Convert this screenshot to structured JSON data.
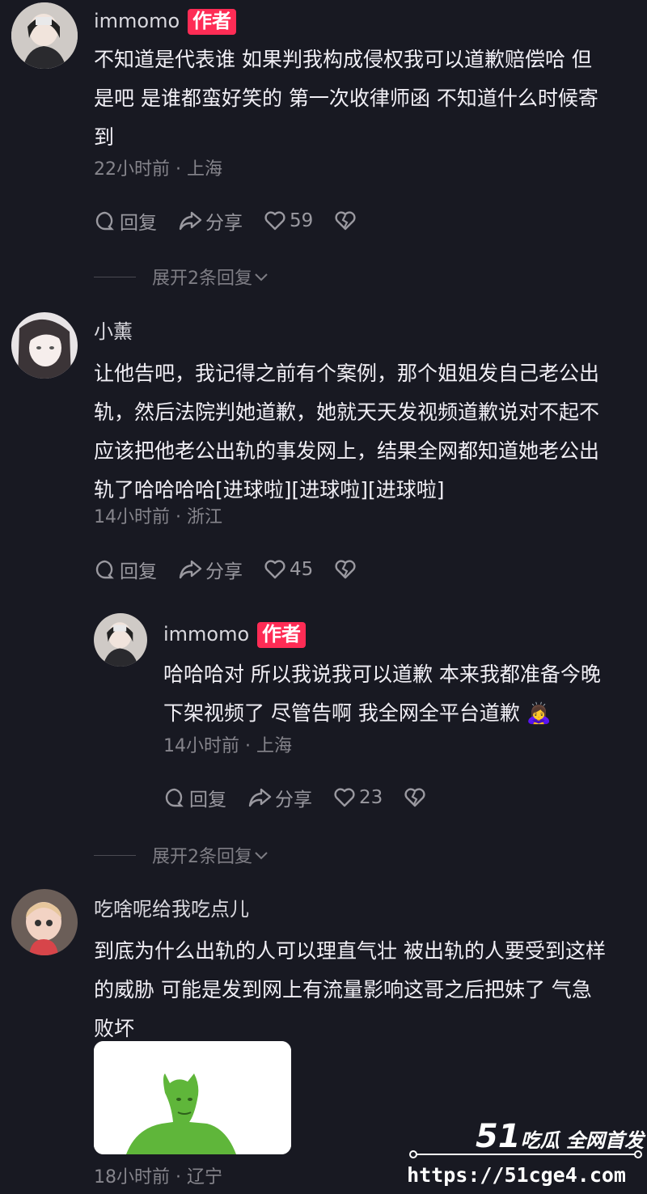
{
  "comments": [
    {
      "username": "immomo",
      "badge": "作者",
      "lines": [
        "不知道是代表谁 如果判我构成侵权我可以道歉赔偿哈 但",
        "是吧 是谁都蛮好笑的 第一次收律师函 不知道什么时候寄",
        "到"
      ],
      "meta": "22小时前 · 上海",
      "reply_label": "回复",
      "share_label": "分享",
      "likes": "59",
      "expand_label": "展开2条回复"
    },
    {
      "username": "小薰",
      "lines": [
        "让他告吧，我记得之前有个案例，那个姐姐发自己老公出",
        "轨，然后法院判她道歉，她就天天发视频道歉说对不起不",
        "应该把他老公出轨的事发网上，结果全网都知道她老公出",
        "轨了哈哈哈哈[进球啦][进球啦][进球啦]"
      ],
      "meta": "14小时前 · 浙江",
      "reply_label": "回复",
      "share_label": "分享",
      "likes": "45",
      "reply": {
        "username": "immomo",
        "badge": "作者",
        "lines": [
          "哈哈哈对 所以我说我可以道歉 本来我都准备今晚",
          "下架视频了 尽管告啊 我全网全平台道歉"
        ],
        "emoji": "🙇‍♀️",
        "meta": "14小时前 · 上海",
        "reply_label": "回复",
        "share_label": "分享",
        "likes": "23"
      },
      "expand_label": "展开2条回复"
    },
    {
      "username": "吃啥呢给我吃点儿",
      "lines": [
        "到底为什么出轨的人可以理直气壮 被出轨的人要受到这样",
        "的威胁 可能是发到网上有流量影响这哥之后把妹了 气急",
        "败坏"
      ],
      "meta": "18小时前 · 辽宁"
    }
  ],
  "watermark": {
    "logo_num": "51",
    "logo_text": "吃瓜 全网首发",
    "url": "https://51cge4.com"
  },
  "colors": {
    "background": "#181922",
    "author_badge": "#fe2c55",
    "meta": "#86858c"
  }
}
